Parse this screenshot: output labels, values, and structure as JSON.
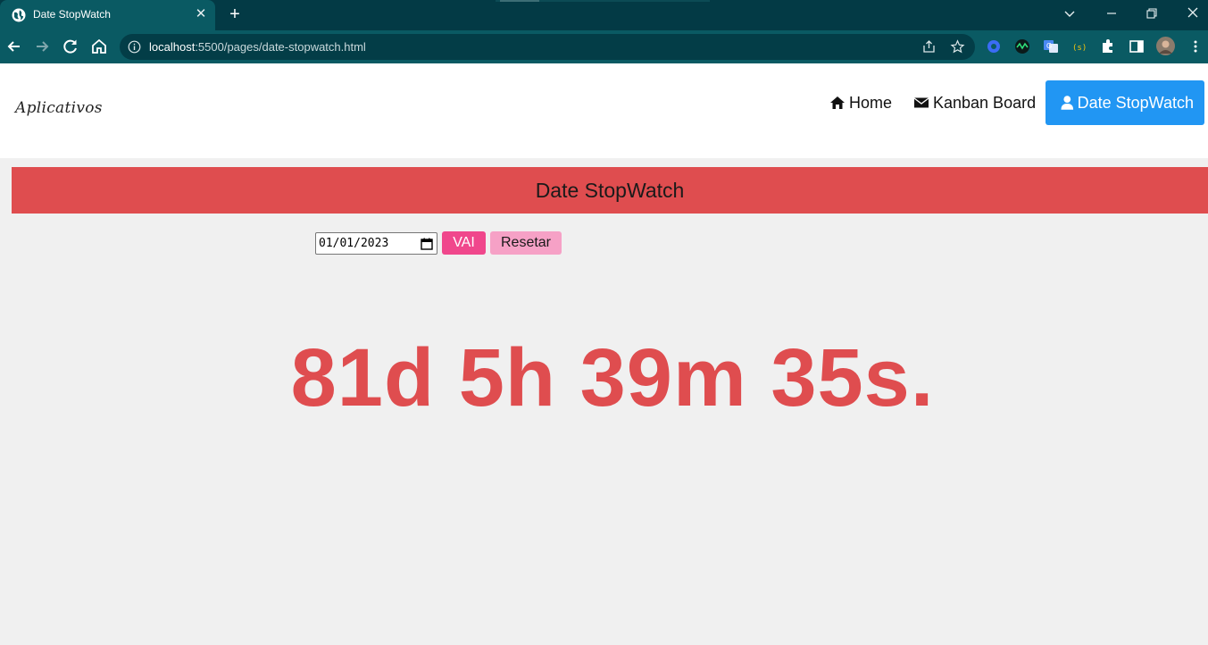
{
  "browser": {
    "tab_title": "Date StopWatch",
    "url_host": "localhost",
    "url_rest": ":5500/pages/date-stopwatch.html"
  },
  "site": {
    "logo": "Aplicativos",
    "nav": [
      {
        "label": "Home",
        "icon": "home-icon"
      },
      {
        "label": "Kanban Board",
        "icon": "envelope-icon"
      },
      {
        "label": "Date StopWatch",
        "icon": "user-icon",
        "active": true
      }
    ]
  },
  "main": {
    "heading": "Date StopWatch",
    "date_value": "01/01/2023",
    "go_button": "VAI",
    "reset_button": "Resetar",
    "countdown": "81d 5h 39m 35s."
  },
  "colors": {
    "accent_red": "#df4d4f",
    "active_nav": "#2196f3",
    "go_button": "#f0478c",
    "reset_button": "#f6a1c6",
    "chrome_dark": "#033a45",
    "chrome_toolbar": "#0a5a63"
  }
}
